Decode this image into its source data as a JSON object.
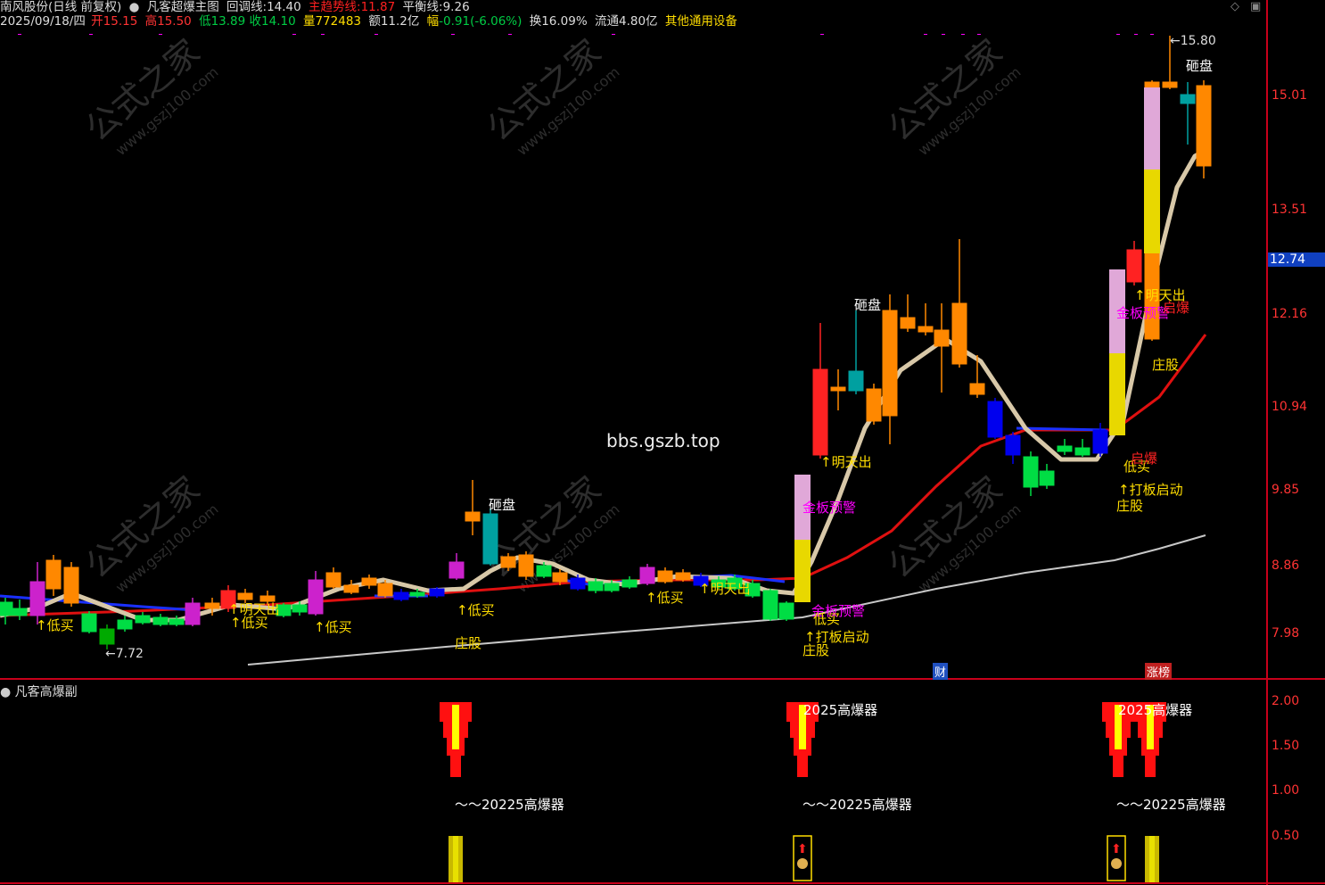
{
  "header": {
    "stock_name": "南风股份(日线 前复权)",
    "indicator_name": "凡客超爆主图",
    "pullback_label": "回调线:",
    "pullback_value": "14.40",
    "trend_label": "主趋势线:",
    "trend_value": "11.87",
    "balance_label": "平衡线:",
    "balance_value": "9.26"
  },
  "quote": {
    "date": "2025/09/18/四",
    "open_label": "开",
    "open": "15.15",
    "high_label": "高",
    "high": "15.50",
    "low_label": "低",
    "low": "13.89",
    "close_label": "收",
    "close": "14.10",
    "vol_label": "量",
    "vol": "772483",
    "amt_label": "额",
    "amt": "11.2亿",
    "chg_label": "幅",
    "chg": "-0.91(-6.06%)",
    "turnover_label": "换",
    "turnover": "16.09%",
    "float_label": "流通",
    "float": "4.80亿",
    "industry": "其他通用设备"
  },
  "price_axis": {
    "labels": [
      "15.01",
      "13.51",
      "12.74",
      "12.16",
      "10.94",
      "9.85",
      "8.86",
      "7.98"
    ],
    "current": "12.74"
  },
  "sub_axis": {
    "labels": [
      "2.00",
      "1.50",
      "1.00",
      "0.50"
    ]
  },
  "watermark": {
    "text": "bbs.gszb.top",
    "logo_cn": "公式之家",
    "logo_url": "www.gszj100.com"
  },
  "annotations": {
    "max_price": "15.80",
    "min_price": "7.72",
    "smash": "砸盘",
    "low_buy": "↑低买",
    "tomorrow_out": "↑明天出",
    "gold_board_alert": "金板预警",
    "board_start": "↑打板启动",
    "banker_stock": "庄股",
    "low_buy2": "低买",
    "plan_explode": "启爆",
    "caiwu_tag": "财",
    "rise_list_tag": "涨榜"
  },
  "sub_panel": {
    "title": "凡客高爆副",
    "label_a": "2025高爆器",
    "label_b": "～～20225高爆器"
  },
  "colors": {
    "bg": "#000000",
    "up": "#ff3333",
    "down": "#00cc44",
    "trend": "#e01010",
    "pullback": "#d8c8a8",
    "balance": "#c8c8c8",
    "axis_red": "#ff3333",
    "label_yellow": "#ffdd00",
    "label_magenta": "#ff00ff"
  }
}
